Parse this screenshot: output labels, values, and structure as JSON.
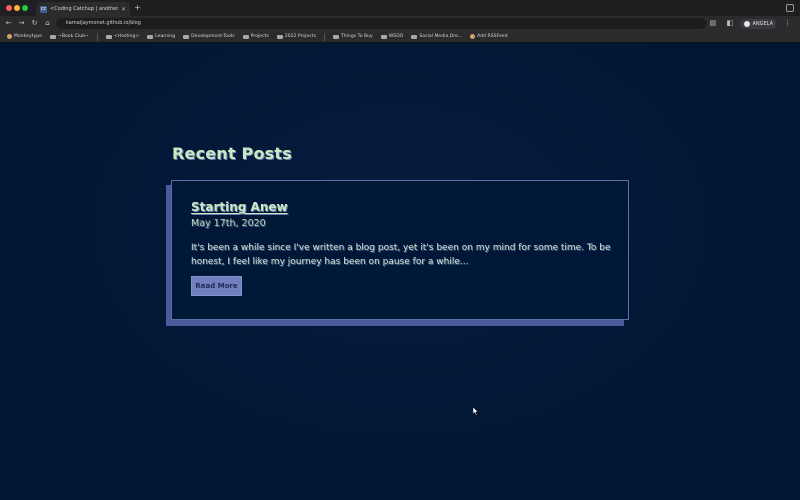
{
  "browser": {
    "tab": {
      "favicon": "cc",
      "title": "<Coding Catchup | another coder...",
      "close_icon": "close-icon"
    },
    "new_tab_symbol": "+",
    "url": "kamaljaymonet.github.io/blog",
    "profile_label": "ANGELA",
    "bookmarks": [
      {
        "label": "Monkeytype",
        "icon": "bookmark-dot-icon"
      },
      {
        "label": "~Book Club~",
        "icon": "folder-icon"
      },
      {
        "label": "<Hosting>",
        "icon": "folder-icon"
      },
      {
        "label": "Learning",
        "icon": "folder-icon"
      },
      {
        "label": "Development-Tools",
        "icon": "folder-icon"
      },
      {
        "label": "Projects",
        "icon": "folder-icon"
      },
      {
        "label": "2022 Projects",
        "icon": "folder-icon"
      },
      {
        "label": "Things To Buy",
        "icon": "folder-icon"
      },
      {
        "label": "WSDO",
        "icon": "folder-icon"
      },
      {
        "label": "Social Media,Dro...",
        "icon": "folder-icon"
      },
      {
        "label": "Add RSSFeed",
        "icon": "bookmark-dot-icon"
      }
    ]
  },
  "blog": {
    "section_heading": "Recent Posts",
    "posts": [
      {
        "title": "Starting Anew",
        "date": "May 17th, 2020",
        "excerpt": "It's been a while since I've written a blog post, yet it's been on my mind for some time. To be honest, I feel like my journey has been on pause for a while...",
        "read_more_label": "Read More"
      }
    ]
  },
  "colors": {
    "page_background": "#001634",
    "heading_text": "#c8e8c2",
    "card_border": "#5d6fa5",
    "card_shadow": "#4a5b9b",
    "button_background": "#6f7fbf"
  }
}
